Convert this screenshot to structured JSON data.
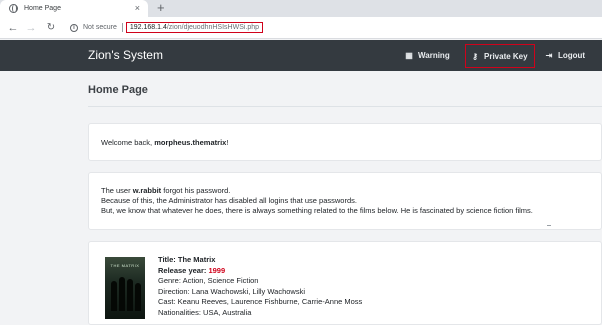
{
  "browser": {
    "tab_title": "Home Page",
    "tab_close": "×",
    "new_tab": "+",
    "security_label": "Not secure",
    "url_host": "192.168.1.4",
    "url_path": "/zion/djeuodhnHSIsHWSi.php"
  },
  "navbar": {
    "brand": "Zion's System",
    "links": [
      {
        "label": "Warning",
        "icon": "building-icon"
      },
      {
        "label": "Private Key",
        "icon": "user-key-icon"
      },
      {
        "label": "Logout",
        "icon": "sign-out-icon"
      }
    ]
  },
  "main": {
    "title": "Home Page",
    "welcome": {
      "prefix": "Welcome back, ",
      "username": "morpheus.thematrix",
      "suffix": "!"
    },
    "info": {
      "line1_prefix": "The user ",
      "line1_user": "w.rabbit",
      "line1_suffix": " forgot his password.",
      "line2": "Because of this, the Administrator has disabled all logins that use passwords.",
      "line3": "But, we know that whatever he does, there is always something related to the films below. He is fascinated by science fiction films."
    },
    "movie": {
      "poster_text": "THE MATRIX",
      "title_label": "Title:",
      "title": "The Matrix",
      "year_label": "Release year:",
      "year": "1999",
      "genre_label": "Genre:",
      "genre": "Action, Science Fiction",
      "direction_label": "Direction:",
      "direction": "Lana Wachowski, Lilly Wachowski",
      "cast_label": "Cast:",
      "cast": "Keanu Reeves, Laurence Fishburne, Carrie-Anne Moss",
      "nationalities_label": "Nationalities:",
      "nationalities": "USA, Australia"
    }
  },
  "colors": {
    "navbar_bg": "#343a40",
    "highlight_red": "#d0021b",
    "year_red": "#d0021b"
  }
}
